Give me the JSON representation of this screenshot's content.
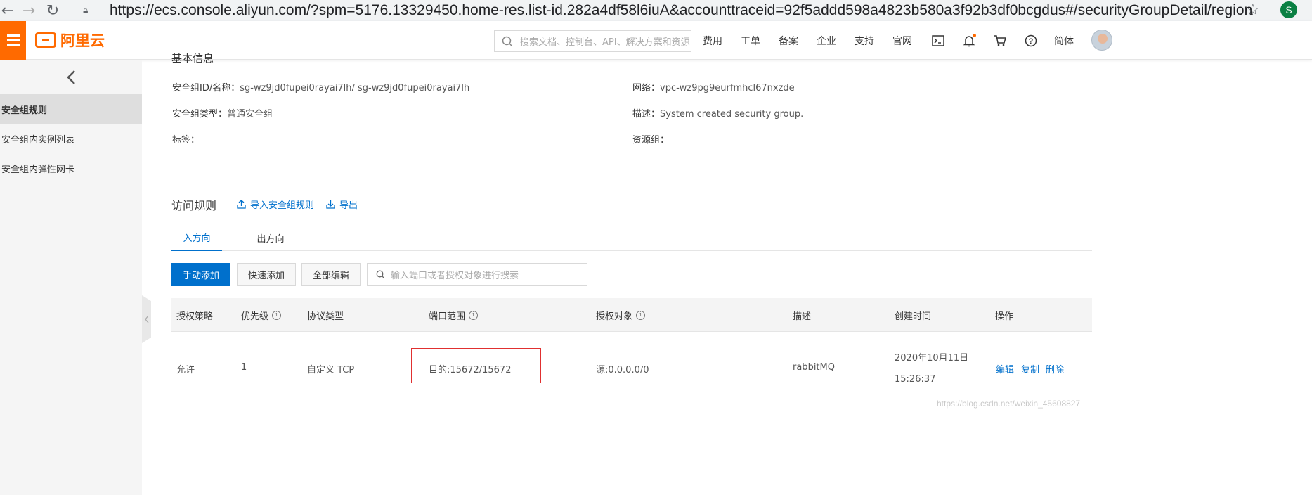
{
  "browser": {
    "url": "https://ecs.console.aliyun.com/?spm=5176.13329450.home-res.list-id.282a4df58l6iuA&accounttraceid=92f5addd598a4823b580a3f92b3df0bcgdus#/securityGroupDetail/region/cn-shenzhe...",
    "profile_initial": "S"
  },
  "header": {
    "logo_text": "阿里云",
    "search_placeholder": "搜索文档、控制台、API、解决方案和资源",
    "nav": [
      "费用",
      "工单",
      "备案",
      "企业",
      "支持",
      "官网"
    ],
    "lang": "简体",
    "brand_color": "#ff6a00"
  },
  "sidebar": {
    "items": [
      {
        "label": "安全组规则",
        "active": true
      },
      {
        "label": "安全组内实例列表",
        "active": false
      },
      {
        "label": "安全组内弹性网卡",
        "active": false
      }
    ]
  },
  "basic_info": {
    "title": "基本信息",
    "sg_id_label": "安全组ID/名称：",
    "sg_id_value": "sg-wz9jd0fupei0rayai7lh/ sg-wz9jd0fupei0rayai7lh",
    "network_label": "网络：",
    "network_value": "vpc-wz9pg9eurfmhcl67nxzde",
    "type_label": "安全组类型：",
    "type_value": "普通安全组",
    "desc_label": "描述：",
    "desc_value": "System created security group.",
    "tags_label": "标签：",
    "resource_group_label": "资源组："
  },
  "rules": {
    "title": "访问规则",
    "import_label": "导入安全组规则",
    "export_label": "导出",
    "tabs": [
      "入方向",
      "出方向"
    ],
    "add_manual": "手动添加",
    "add_quick": "快速添加",
    "edit_all": "全部编辑",
    "search_placeholder": "输入端口或者授权对象进行搜索",
    "columns": [
      "授权策略",
      "优先级",
      "协议类型",
      "端口范围",
      "授权对象",
      "描述",
      "创建时间",
      "操作"
    ],
    "row": {
      "policy": "允许",
      "priority": "1",
      "protocol": "自定义 TCP",
      "port": "目的:15672/15672",
      "source": "源:0.0.0.0/0",
      "description": "rabbitMQ",
      "created_date": "2020年10月11日",
      "created_time": "15:26:37",
      "actions": [
        "编辑",
        "复制",
        "删除"
      ]
    }
  },
  "watermark": "https://blog.csdn.net/weixin_45608827"
}
